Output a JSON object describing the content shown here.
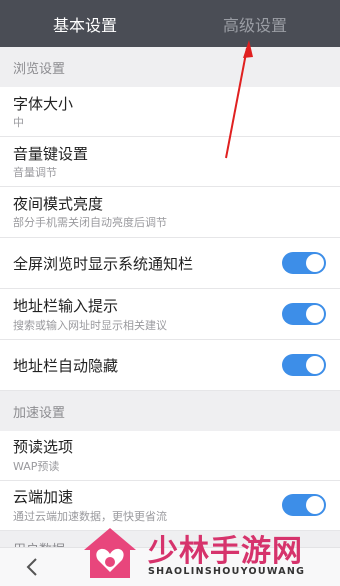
{
  "tabs": {
    "basic": "基本设置",
    "advanced": "高级设置"
  },
  "sections": {
    "browse": "浏览设置",
    "accelerate": "加速设置",
    "user": "用户数据"
  },
  "items": {
    "font_size": {
      "title": "字体大小",
      "sub": "中"
    },
    "volume_key": {
      "title": "音量键设置",
      "sub": "音量调节"
    },
    "night_brightness": {
      "title": "夜间模式亮度",
      "sub": "部分手机需关闭自动亮度后调节"
    },
    "fullscreen_notify": {
      "title": "全屏浏览时显示系统通知栏",
      "enabled": true
    },
    "address_hint": {
      "title": "地址栏输入提示",
      "sub": "搜索或输入网址时显示相关建议",
      "enabled": true
    },
    "address_autohide": {
      "title": "地址栏自动隐藏",
      "enabled": true
    },
    "preread": {
      "title": "预读选项",
      "sub": "WAP预读"
    },
    "cloud_accel": {
      "title": "云端加速",
      "sub": "通过云端加速数据，更快更省流",
      "enabled": true
    }
  },
  "watermark": {
    "title": "少林手游网",
    "sub": "SHAOLINSHOUYOUWANG"
  },
  "colors": {
    "tabbar": "#4a4d55",
    "toggle_on": "#3d8ee8",
    "arrow": "#e02020",
    "watermark": "#d6336c"
  }
}
